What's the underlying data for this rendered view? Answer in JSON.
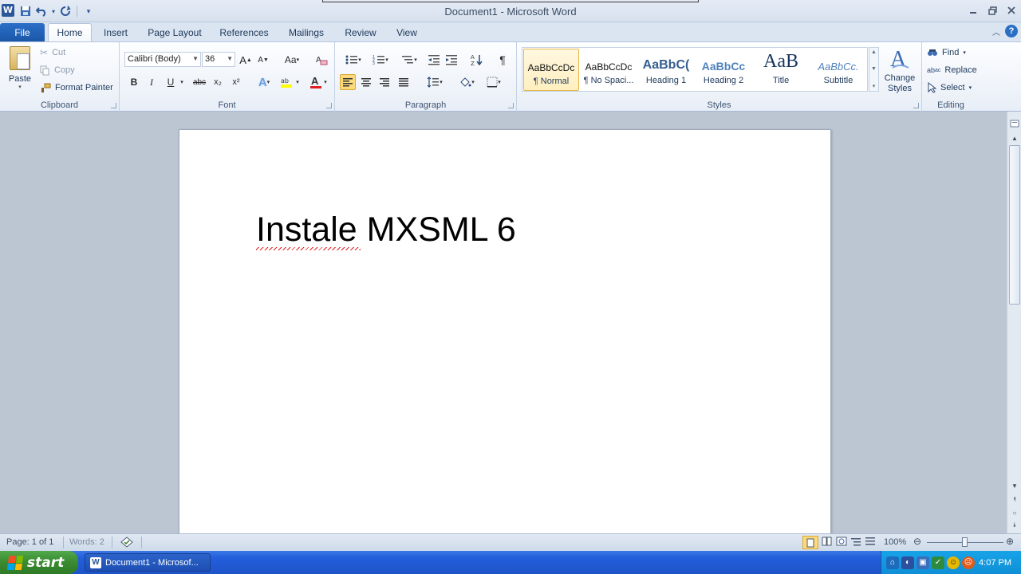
{
  "window": {
    "title": "Document1  -  Microsoft Word"
  },
  "qat": {
    "icons": [
      "save-icon",
      "undo-icon",
      "redo-icon",
      "customize-icon"
    ]
  },
  "tabs": {
    "file": "File",
    "items": [
      {
        "label": "Home",
        "active": true
      },
      {
        "label": "Insert"
      },
      {
        "label": "Page Layout"
      },
      {
        "label": "References"
      },
      {
        "label": "Mailings"
      },
      {
        "label": "Review"
      },
      {
        "label": "View"
      }
    ]
  },
  "clipboard": {
    "label": "Clipboard",
    "paste": "Paste",
    "cut": "Cut",
    "copy": "Copy",
    "format_painter": "Format Painter"
  },
  "font": {
    "label": "Font",
    "font_name": "Calibri (Body)",
    "font_size": "36",
    "bold": "B",
    "italic": "I",
    "underline": "U",
    "strikethrough": "abc",
    "subscript": "x₂",
    "superscript": "x²",
    "grow": "A",
    "shrink": "A",
    "change_case": "Aa"
  },
  "paragraph": {
    "label": "Paragraph",
    "show_marks": "¶"
  },
  "styles": {
    "label": "Styles",
    "tiles": [
      {
        "sample": "AaBbCcDc",
        "name": "¶ Normal",
        "selected": true
      },
      {
        "sample": "AaBbCcDc",
        "name": "¶ No Spaci..."
      },
      {
        "sample": "AaBbC(",
        "name": "Heading 1"
      },
      {
        "sample": "AaBbCc",
        "name": "Heading 2"
      },
      {
        "sample": "AaB",
        "name": "Title"
      },
      {
        "sample": "AaBbCc.",
        "name": "Subtitle"
      }
    ],
    "change_styles": "Change Styles"
  },
  "editing": {
    "label": "Editing",
    "find": "Find",
    "replace": "Replace",
    "select": "Select"
  },
  "document": {
    "text": "Instale MXSML 6"
  },
  "status": {
    "page": "Page: 1 of 1",
    "words": "Words: 2",
    "zoom": "100%"
  },
  "taskbar": {
    "start": "start",
    "task": "Document1 - Microsof...",
    "clock": "4:07 PM"
  },
  "colors": {
    "accent": "#2b579a",
    "file_tab": "#1a57a8",
    "taskbar": "#245edb",
    "start": "#3b8c32"
  }
}
